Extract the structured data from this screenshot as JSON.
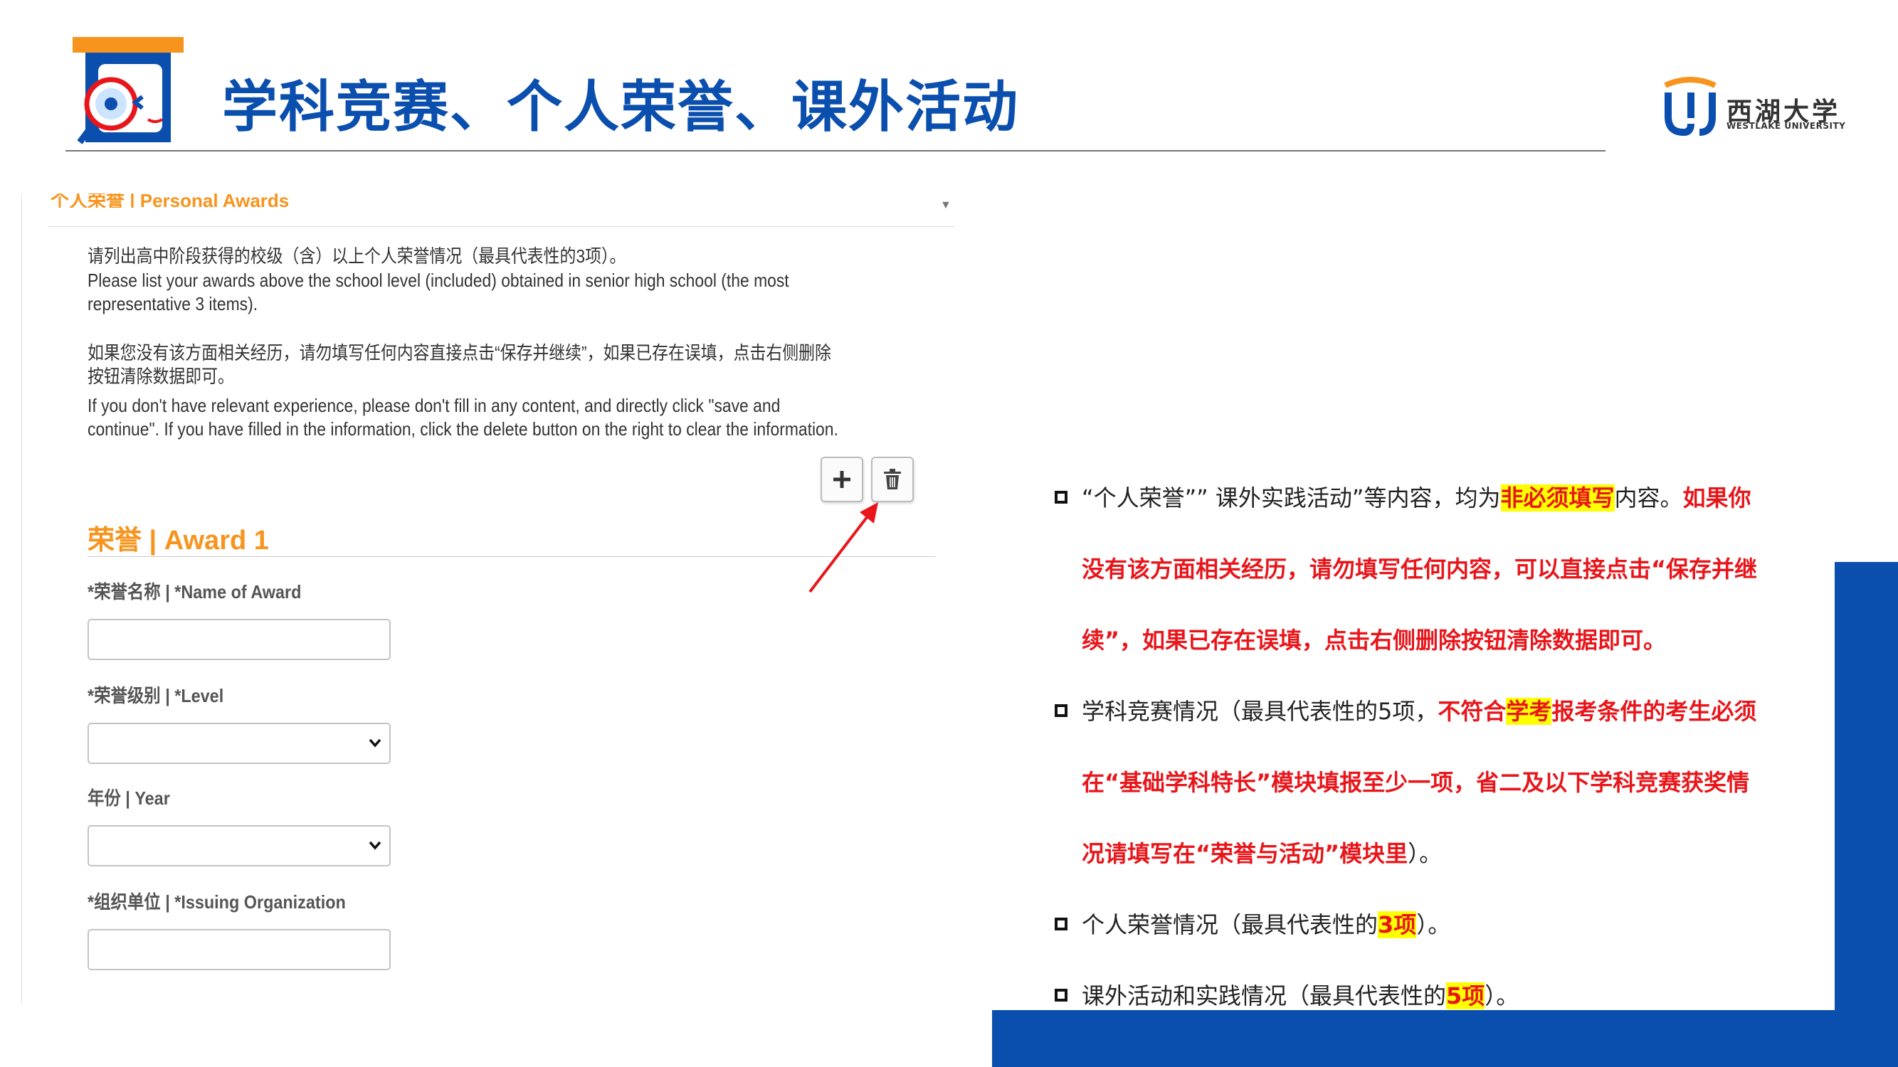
{
  "header": {
    "title": "学科竞赛、个人荣誉、课外活动",
    "university_cn": "西湖大学",
    "university_en": "WESTLAKE UNIVERSITY"
  },
  "form": {
    "section_title": "个人荣誉 | Personal Awards",
    "instructions": {
      "cn1": "请列出高中阶段获得的校级（含）以上个人荣誉情况（最具代表性的3项）。",
      "en1": "Please list your awards above the school level (included) obtained in senior high school (the most representative 3 items).",
      "cn2": "如果您没有该方面相关经历，请勿填写任何内容直接点击“保存并继续”，如果已存在误填，点击右侧删除按钮清除数据即可。",
      "en2": "If you don't have relevant experience, please don't fill in any content, and directly click \"save and continue\". If you have filled in the information, click the delete button on the right to clear the information."
    },
    "award_heading": "荣誉 | Award 1",
    "fields": {
      "name_label": "*荣誉名称 | *Name of Award",
      "level_label": "*荣誉级别 | *Level",
      "year_label": "年份 | Year",
      "org_label": "*组织单位 | *Issuing Organization"
    }
  },
  "notes": {
    "n1": {
      "a": "“个人荣誉”” 课外实践活动”等内容，均为",
      "b": "非必须填写",
      "c": "内容。",
      "d": "如果你没有该方面相关经历，请勿填写任何内容，可以直接点击“保存并继续”，如果已存在误填，点击右侧删除按钮清除数据即可。"
    },
    "n2": {
      "a": "学科竞赛情况（最具代表性的5项，",
      "b": "不符合",
      "c": "学考",
      "d": "报考条件的考生必须在“基础学科特长”模块填报至少一项，省二及以下学科竞赛获奖情况请填写在“荣誉与活动”模块里",
      "e": "）。"
    },
    "n3": {
      "a": "个人荣誉情况（最具代表性的",
      "b": "3项",
      "c": "）。"
    },
    "n4": {
      "a": "课外活动和实践情况（最具代表性的",
      "b": "5项",
      "c": "）。"
    }
  },
  "colors": {
    "brand_blue": "#0b4fae",
    "accent_orange": "#f7941d",
    "note_red": "#e8161b",
    "highlight_yellow": "#ffff00"
  },
  "icons": [
    "book-icon",
    "magnifier-icon",
    "plus-icon",
    "trash-icon",
    "chevron-down-icon",
    "red-arrow-icon",
    "university-logo"
  ]
}
